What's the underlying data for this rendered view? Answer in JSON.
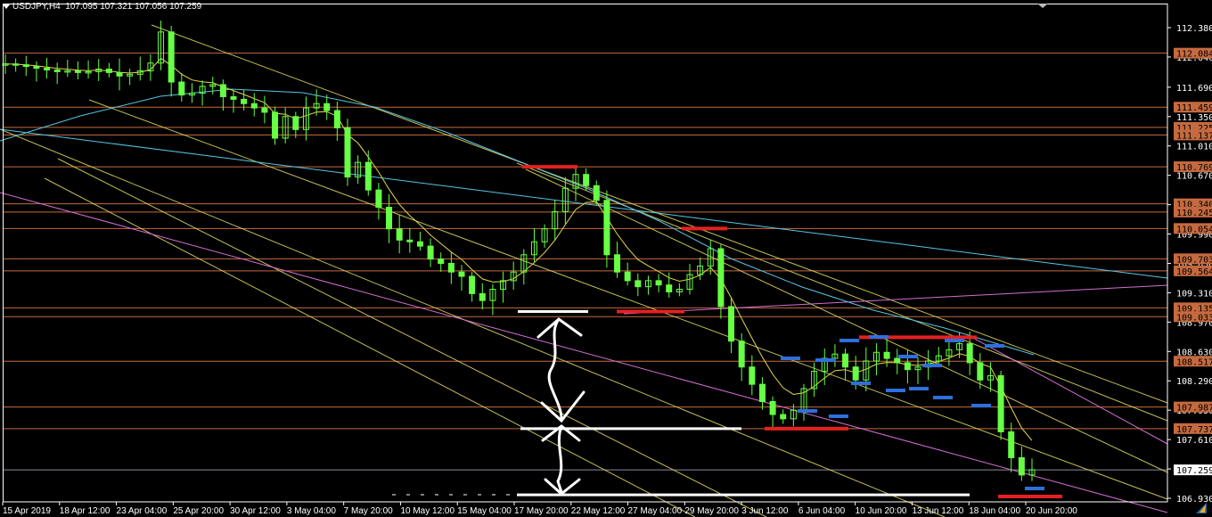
{
  "header": {
    "title": "USDJPY,H4",
    "ohlc": "107.095 107.321 107.056 107.259"
  },
  "colors": {
    "background": "#000000",
    "frame": "#ffffff",
    "candles": "#66ff44",
    "channel_lines": "#e6e066",
    "hline": "#c56a3f",
    "price_label_bg": "#c56a3f",
    "ma_fast": "#e6d84a",
    "ma_slow": "#55c7e6",
    "ma_long": "#55c7e6",
    "pink_line": "#d36fd3",
    "red_marks": "#e62020",
    "blue_marks": "#2f6fdc",
    "arrow_drawing": "#ffffff"
  },
  "chart_data": {
    "type": "candlestick",
    "symbol": "USDJPY",
    "timeframe": "H4",
    "ylim": [
      106.93,
      112.48
    ],
    "y_ticks": [
      "112.380",
      "112.040",
      "111.690",
      "111.350",
      "111.010",
      "110.670",
      "110.330",
      "109.990",
      "109.650",
      "109.310",
      "108.970",
      "108.630",
      "108.290",
      "107.950",
      "107.610",
      "107.270",
      "106.930"
    ],
    "x_ticks": [
      "15 Apr 2019",
      "18 Apr 12:00",
      "23 Apr 04:00",
      "25 Apr 20:00",
      "30 Apr 12:00",
      "3 May 04:00",
      "7 May 20:00",
      "10 May 12:00",
      "15 May 04:00",
      "17 May 20:00",
      "22 May 12:00",
      "27 May 04:00",
      "29 May 20:00",
      "3 Jun 12:00",
      "6 Jun 04:00",
      "10 Jun 20:00",
      "13 Jun 12:00",
      "18 Jun 04:00",
      "20 Jun 20:00"
    ],
    "price_levels": [
      "112.084",
      "111.459",
      "111.225",
      "111.137",
      "110.769",
      "110.340",
      "110.245",
      "110.054",
      "109.703",
      "109.564",
      "109.135",
      "109.033",
      "108.517",
      "107.987",
      "107.737"
    ],
    "current_price": "107.259",
    "close_series": [
      111.96,
      111.95,
      111.93,
      111.91,
      111.89,
      111.87,
      111.88,
      111.86,
      111.87,
      111.9,
      111.86,
      111.82,
      111.84,
      111.88,
      111.97,
      112.33,
      111.75,
      111.6,
      111.62,
      111.7,
      111.72,
      111.58,
      111.55,
      111.5,
      111.45,
      111.4,
      111.1,
      111.35,
      111.2,
      111.45,
      111.5,
      111.42,
      111.22,
      110.65,
      110.82,
      110.5,
      110.3,
      110.05,
      109.92,
      109.9,
      109.85,
      109.7,
      109.65,
      109.55,
      109.5,
      109.3,
      109.22,
      109.35,
      109.45,
      109.55,
      109.75,
      109.9,
      110.05,
      110.25,
      110.52,
      110.68,
      110.55,
      110.38,
      109.75,
      109.55,
      109.45,
      109.38,
      109.45,
      109.4,
      109.32,
      109.35,
      109.52,
      109.62,
      109.82,
      109.15,
      108.75,
      108.45,
      108.25,
      108.05,
      107.9,
      107.85,
      107.95,
      108.2,
      108.4,
      108.55,
      108.6,
      108.45,
      108.3,
      108.52,
      108.62,
      108.55,
      108.5,
      108.42,
      108.45,
      108.52,
      108.58,
      108.65,
      108.72,
      108.5,
      108.3,
      108.35,
      107.7,
      107.4,
      107.2,
      107.26
    ],
    "annotations": {
      "red_segments": [
        110.769,
        110.054,
        109.093,
        107.737,
        108.795,
        106.95
      ],
      "white_segments": [
        109.093,
        107.737,
        106.97
      ]
    }
  }
}
